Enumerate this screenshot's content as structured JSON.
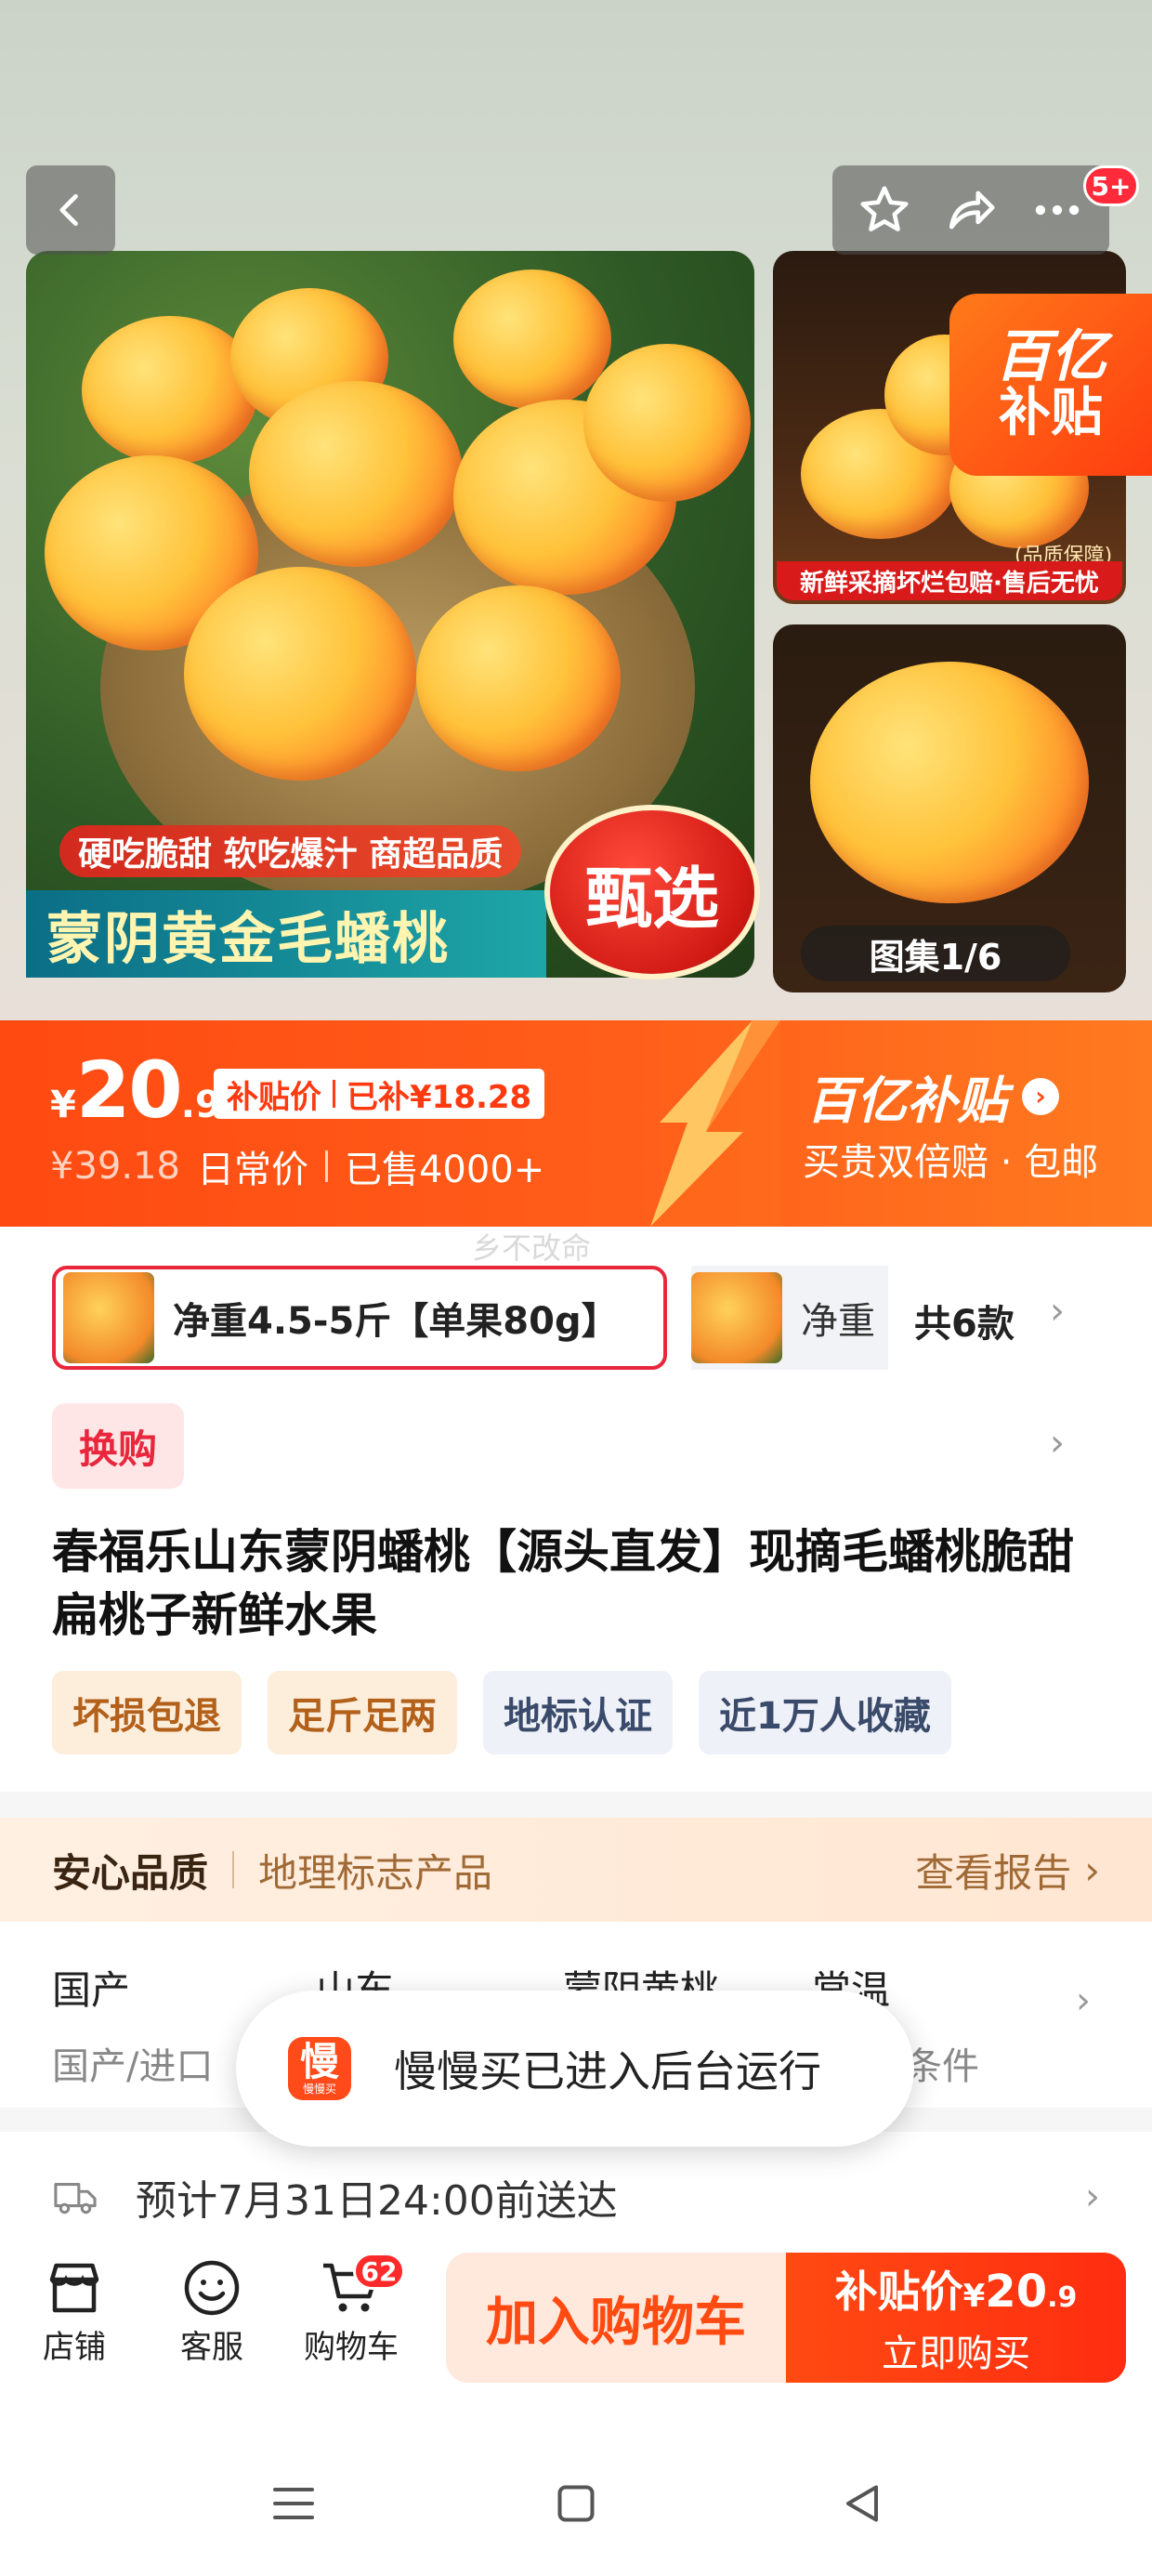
{
  "gallery": {
    "main_tagline": "硬吃脆甜 软吃爆汁 商超品质",
    "main_title": "蒙阴黄金毛蟠桃",
    "main_badge": "甄选",
    "side_caption": "新鲜采摘坏烂包赔·售后无忧",
    "side_caption_small": "(品质保障)",
    "yi_badge_line1": "百亿",
    "yi_badge_line2": "补贴",
    "count": "图集1/6",
    "notification_count": "5+",
    "icons": [
      "back-icon",
      "star-icon",
      "share-icon",
      "more-icon"
    ]
  },
  "price": {
    "currency": "¥",
    "integer": "20",
    "decimal": ".9",
    "subsidy_label": "补贴价",
    "subsidy_amount": "已补¥18.28",
    "original": "¥39.18",
    "original_label": "日常价",
    "sold": "已售4000+",
    "brand": "百亿补贴",
    "brand_sub": "买贵双倍赔 · 包邮"
  },
  "watermark": "乡不改命",
  "variants": {
    "selected": "净重4.5-5斤【单果80g】",
    "second": "净重",
    "total": "共6款"
  },
  "huangou": "换购",
  "product_title": "春福乐山东蒙阴蟠桃【源头直发】现摘毛蟠桃脆甜扁桃子新鲜水果",
  "tags": [
    {
      "label": "坏损包退",
      "style": "warm"
    },
    {
      "label": "足斤足两",
      "style": "warm"
    },
    {
      "label": "地标认证",
      "style": "cool"
    },
    {
      "label": "近1万人收藏",
      "style": "cool"
    }
  ],
  "quality": {
    "title": "安心品质",
    "subtitle": "地理标志产品",
    "report": "查看报告"
  },
  "specs": [
    {
      "value": "国产",
      "key": "国产/进口"
    },
    {
      "value": "山东",
      "key": ""
    },
    {
      "value": "蒙阴黄桃",
      "key": ""
    },
    {
      "value": "常温",
      "key": "条件"
    }
  ],
  "toast": {
    "app_name": "慢",
    "app_sub": "慢慢买",
    "message": "慢慢买已进入后台运行"
  },
  "delivery": "预计7月31日24:00前送达",
  "bottom": {
    "store": "店铺",
    "service": "客服",
    "cart": "购物车",
    "cart_count": "62",
    "add_to_cart": "加入购物车",
    "buy_label": "补贴价",
    "buy_currency": "¥",
    "buy_int": "20",
    "buy_dec": ".9",
    "buy_now": "立即购买"
  },
  "colors": {
    "accent": "#ff4a12",
    "red": "#e8263c"
  }
}
